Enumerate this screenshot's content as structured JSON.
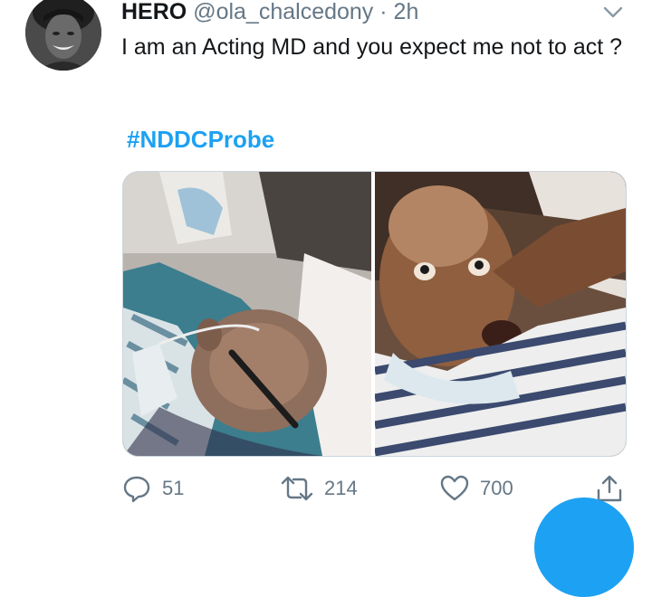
{
  "tweet": {
    "display_name": "HERO",
    "handle": "@ola_chalcedony",
    "separator": "·",
    "time": "2h",
    "text": "I am an Acting MD and you expect me not to act ?",
    "hashtag": "#NDDCProbe"
  },
  "actions": {
    "reply_count": "51",
    "retweet_count": "214",
    "like_count": "700"
  },
  "icons": {
    "reply": "reply-icon",
    "retweet": "retweet-icon",
    "like": "heart-icon",
    "share": "share-icon",
    "menu": "chevron-down-icon"
  },
  "colors": {
    "accent": "#1da1f2",
    "secondary_text": "#657786",
    "primary_text": "#14171a",
    "border": "#ccd6dd"
  }
}
